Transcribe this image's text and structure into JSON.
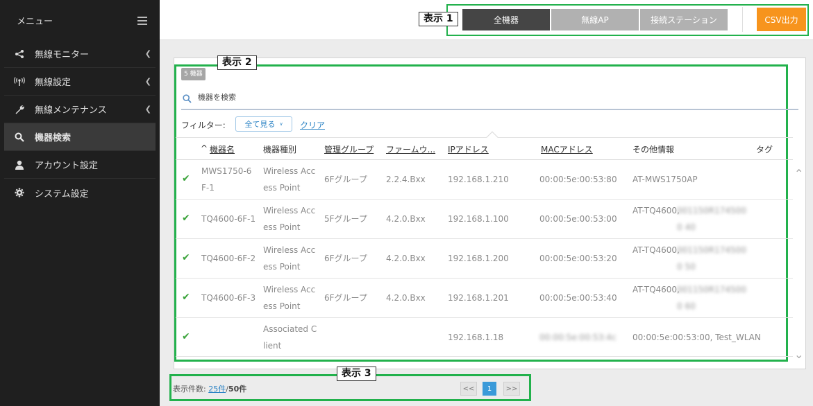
{
  "sidebar": {
    "title": "メニュー",
    "items": [
      {
        "label": "無線モニター",
        "icon": "share-icon",
        "has_submenu": true
      },
      {
        "label": "無線設定",
        "icon": "antenna-icon",
        "has_submenu": true
      },
      {
        "label": "無線メンテナンス",
        "icon": "wrench-icon",
        "has_submenu": true
      },
      {
        "label": "機器検索",
        "icon": "search-icon",
        "has_submenu": false,
        "active": true
      },
      {
        "label": "アカウント設定",
        "icon": "user-icon",
        "has_submenu": false
      },
      {
        "label": "システム設定",
        "icon": "gear-icon",
        "has_submenu": false
      }
    ]
  },
  "topbar": {
    "annotation_1": "表示 1",
    "seg_all": "全機器",
    "seg_ap": "無線AP",
    "seg_station": "接続ステーション",
    "csv": "CSV出力"
  },
  "main": {
    "annotation_2": "表示 2",
    "badge": "5 機器",
    "search_placeholder": "機器を検索",
    "filter_label": "フィルター:",
    "filter_value": "全て見る",
    "clear": "クリア",
    "columns": [
      "機器名",
      "機器種別",
      "管理グループ",
      "ファームウ...",
      "IPアドレス",
      "MACアドレス",
      "その他情報",
      "タグ"
    ],
    "sort_indicator": "^",
    "rows": [
      {
        "name": "MWS1750-6F-1",
        "type": "Wireless Access Point",
        "group": "6Fグループ",
        "firmware": "2.2.4.Bxx",
        "ip": "192.168.1.210",
        "mac": "00:00:5e:00:53:80",
        "info": "AT-MWS1750AP",
        "info_blurred": ""
      },
      {
        "name": "TQ4600-6F-1",
        "type": "Wireless Access Point",
        "group": "5Fグループ",
        "firmware": "4.2.0.Bxx",
        "ip": "192.168.1.100",
        "mac": "00:00:5e:00:53:00",
        "info": "AT-TQ4600,",
        "info_blurred": "001150R1745000 40"
      },
      {
        "name": "TQ4600-6F-2",
        "type": "Wireless Access Point",
        "group": "6Fグループ",
        "firmware": "4.2.0.Bxx",
        "ip": "192.168.1.200",
        "mac": "00:00:5e:00:53:20",
        "info": "AT-TQ4600,",
        "info_blurred": "001150R1745000 50"
      },
      {
        "name": "TQ4600-6F-3",
        "type": "Wireless Access Point",
        "group": "6Fグループ",
        "firmware": "4.2.0.Bxx",
        "ip": "192.168.1.201",
        "mac": "00:00:5e:00:53:40",
        "info": "AT-TQ4600,",
        "info_blurred": "001150R1745000 60"
      },
      {
        "name": "",
        "type": "Associated Client",
        "group": "",
        "firmware": "",
        "ip": "192.168.1.18",
        "mac_blurred": "00:00:5e:00:53:4c",
        "info": "00:00:5e:00:53:00, Test_WLAN"
      }
    ]
  },
  "footer": {
    "annotation_3": "表示 3",
    "count_label": "表示件数:",
    "count_per_page": "25件",
    "count_sep": "/",
    "count_total": "50件",
    "prev": "<<",
    "page": "1",
    "next": ">>"
  },
  "colors": {
    "accent_green": "#22b14c",
    "csv_orange": "#f7941d",
    "link_blue": "#2a82c4",
    "check_green": "#3aa33a"
  }
}
